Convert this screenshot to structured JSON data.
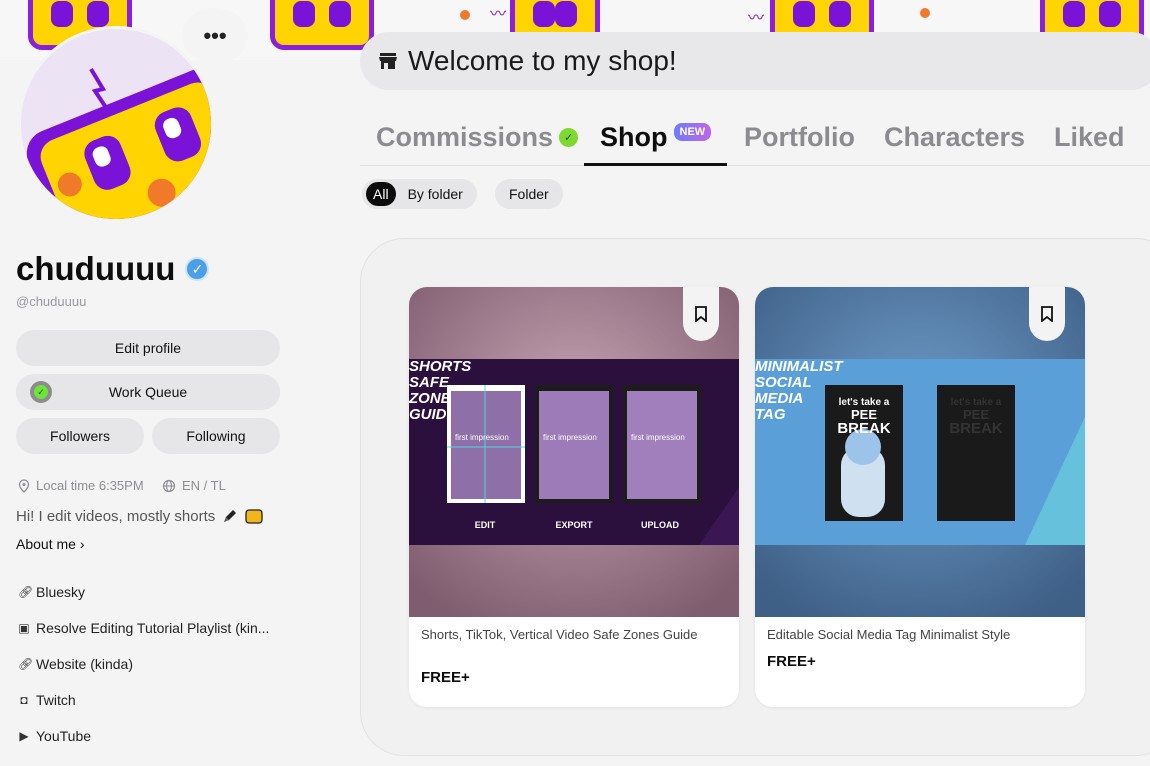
{
  "profile": {
    "username": "chuduuuu",
    "handle": "@chuduuuu",
    "verified_icon": "verified-badge-icon",
    "more_label": "•••",
    "buttons": {
      "edit_profile": "Edit profile",
      "work_queue": "Work Queue",
      "followers": "Followers",
      "following": "Following"
    },
    "local_time": "Local time 6:35PM",
    "languages": "EN / TL",
    "bio": "Hi! I edit videos, mostly shorts",
    "about_me": "About me",
    "links": [
      {
        "label": "Bluesky",
        "icon": "link-icon"
      },
      {
        "label": "Resolve Editing Tutorial Playlist (kin...",
        "icon": "video-icon"
      },
      {
        "label": "Website (kinda)",
        "icon": "link-icon"
      },
      {
        "label": "Twitch",
        "icon": "twitch-icon"
      },
      {
        "label": "YouTube",
        "icon": "youtube-icon"
      }
    ]
  },
  "header": {
    "shop_title": "Welcome to my shop!",
    "shop_icon": "storefront-icon"
  },
  "tabs": [
    {
      "label": "Commissions",
      "active": false
    },
    {
      "label": "Shop",
      "active": true,
      "badge": "NEW"
    },
    {
      "label": "Portfolio",
      "active": false
    },
    {
      "label": "Characters",
      "active": false
    },
    {
      "label": "Liked",
      "active": false
    }
  ],
  "filters": {
    "all": "All",
    "by_folder": "By folder",
    "folder": "Folder"
  },
  "products": [
    {
      "title": "Shorts, TikTok, Vertical Video Safe Zones Guide",
      "price": "FREE+",
      "thumb_heading": [
        "SHORTS",
        "SAFE",
        "ZONE",
        "GUIDE"
      ],
      "thumb_steps": [
        "EDIT",
        "EXPORT",
        "UPLOAD"
      ],
      "thumb_caption": "first impression"
    },
    {
      "title": "Editable Social Media Tag Minimalist Style",
      "price": "FREE+",
      "thumb_heading": [
        "MINIMALIST",
        "SOCIAL",
        "MEDIA",
        "TAG"
      ],
      "thumb_caption": [
        "let's take a",
        "PEE",
        "BREAK"
      ]
    }
  ],
  "colors": {
    "accent_purple": "#7b12d8",
    "accent_yellow": "#ffd400",
    "verified_blue": "#4a9fe8",
    "check_green": "#6ee43a"
  }
}
